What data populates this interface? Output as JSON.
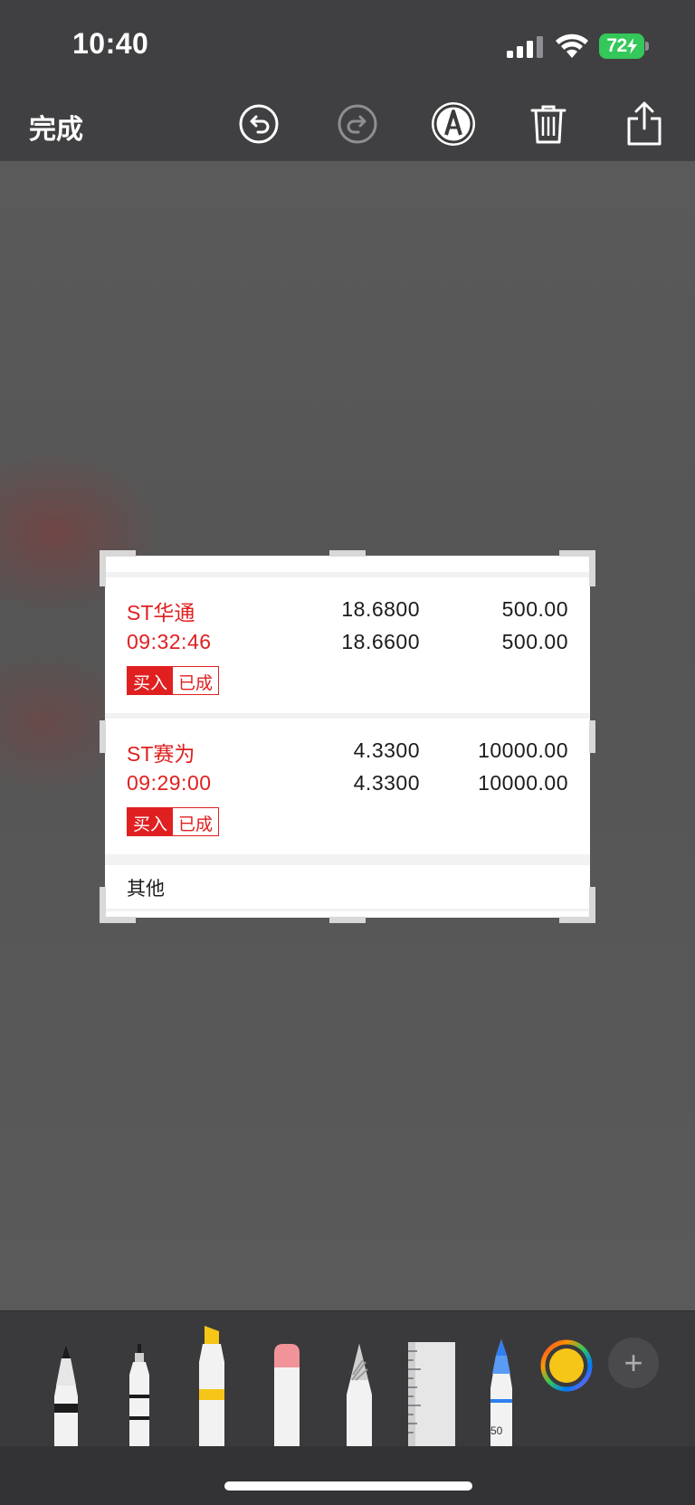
{
  "status_bar": {
    "time": "10:40",
    "battery_percent": "72"
  },
  "toolbar": {
    "done_label": "完成",
    "icons": [
      "undo-icon",
      "redo-icon",
      "markup-icon",
      "trash-icon",
      "share-icon"
    ]
  },
  "orders": [
    {
      "name": "ST华通",
      "time": "09:32:46",
      "price1": "18.6800",
      "qty1": "500.00",
      "price2": "18.6600",
      "qty2": "500.00",
      "side_tag": "买入",
      "status_tag": "已成"
    },
    {
      "name": "ST赛为",
      "time": "09:29:00",
      "price1": "4.3300",
      "qty1": "10000.00",
      "price2": "4.3300",
      "qty2": "10000.00",
      "side_tag": "买入",
      "status_tag": "已成"
    }
  ],
  "footer_label": "其他",
  "drawing_tools": {
    "items": [
      "pen-tool",
      "monoline-tool",
      "highlighter-tool",
      "eraser-tool",
      "pencil-tool",
      "ruler-tool",
      "crayon-tool"
    ],
    "crayon_width_label": "50",
    "selected_color": "#f5c518",
    "add_label": "+"
  },
  "colors": {
    "accent_red": "#e02020",
    "battery_green": "#34c759"
  }
}
